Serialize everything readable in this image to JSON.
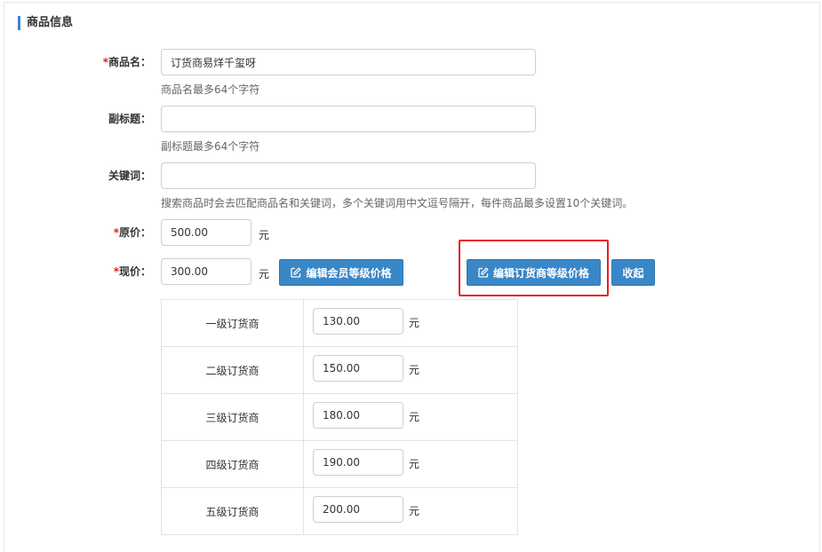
{
  "section": {
    "title": "商品信息"
  },
  "fields": {
    "name": {
      "required_mark": "*",
      "label": "商品名：",
      "value": "订货商易烊千玺呀",
      "help": "商品名最多64个字符"
    },
    "subtitle": {
      "label": "副标题：",
      "value": "",
      "help": "副标题最多64个字符"
    },
    "keywords": {
      "label": "关键词：",
      "value": "",
      "help": "搜索商品时会去匹配商品名和关键词，多个关键词用中文逗号隔开，每件商品最多设置10个关键词。"
    },
    "original_price": {
      "required_mark": "*",
      "label": "原价：",
      "value": "500.00",
      "unit": "元"
    },
    "current_price": {
      "required_mark": "*",
      "label": "现价：",
      "value": "300.00",
      "unit": "元"
    }
  },
  "buttons": {
    "edit_member_price": "编辑会员等级价格",
    "edit_dealer_price": "编辑订货商等级价格",
    "collapse": "收起"
  },
  "dealer_levels": [
    {
      "name": "一级订货商",
      "price": "130.00",
      "unit": "元"
    },
    {
      "name": "二级订货商",
      "price": "150.00",
      "unit": "元"
    },
    {
      "name": "三级订货商",
      "price": "180.00",
      "unit": "元"
    },
    {
      "name": "四级订货商",
      "price": "190.00",
      "unit": "元"
    },
    {
      "name": "五级订货商",
      "price": "200.00",
      "unit": "元"
    }
  ],
  "colors": {
    "accent": "#3a87c8",
    "required": "#e02020",
    "highlight": "#e52020"
  },
  "icons": {
    "edit": "edit-icon"
  }
}
